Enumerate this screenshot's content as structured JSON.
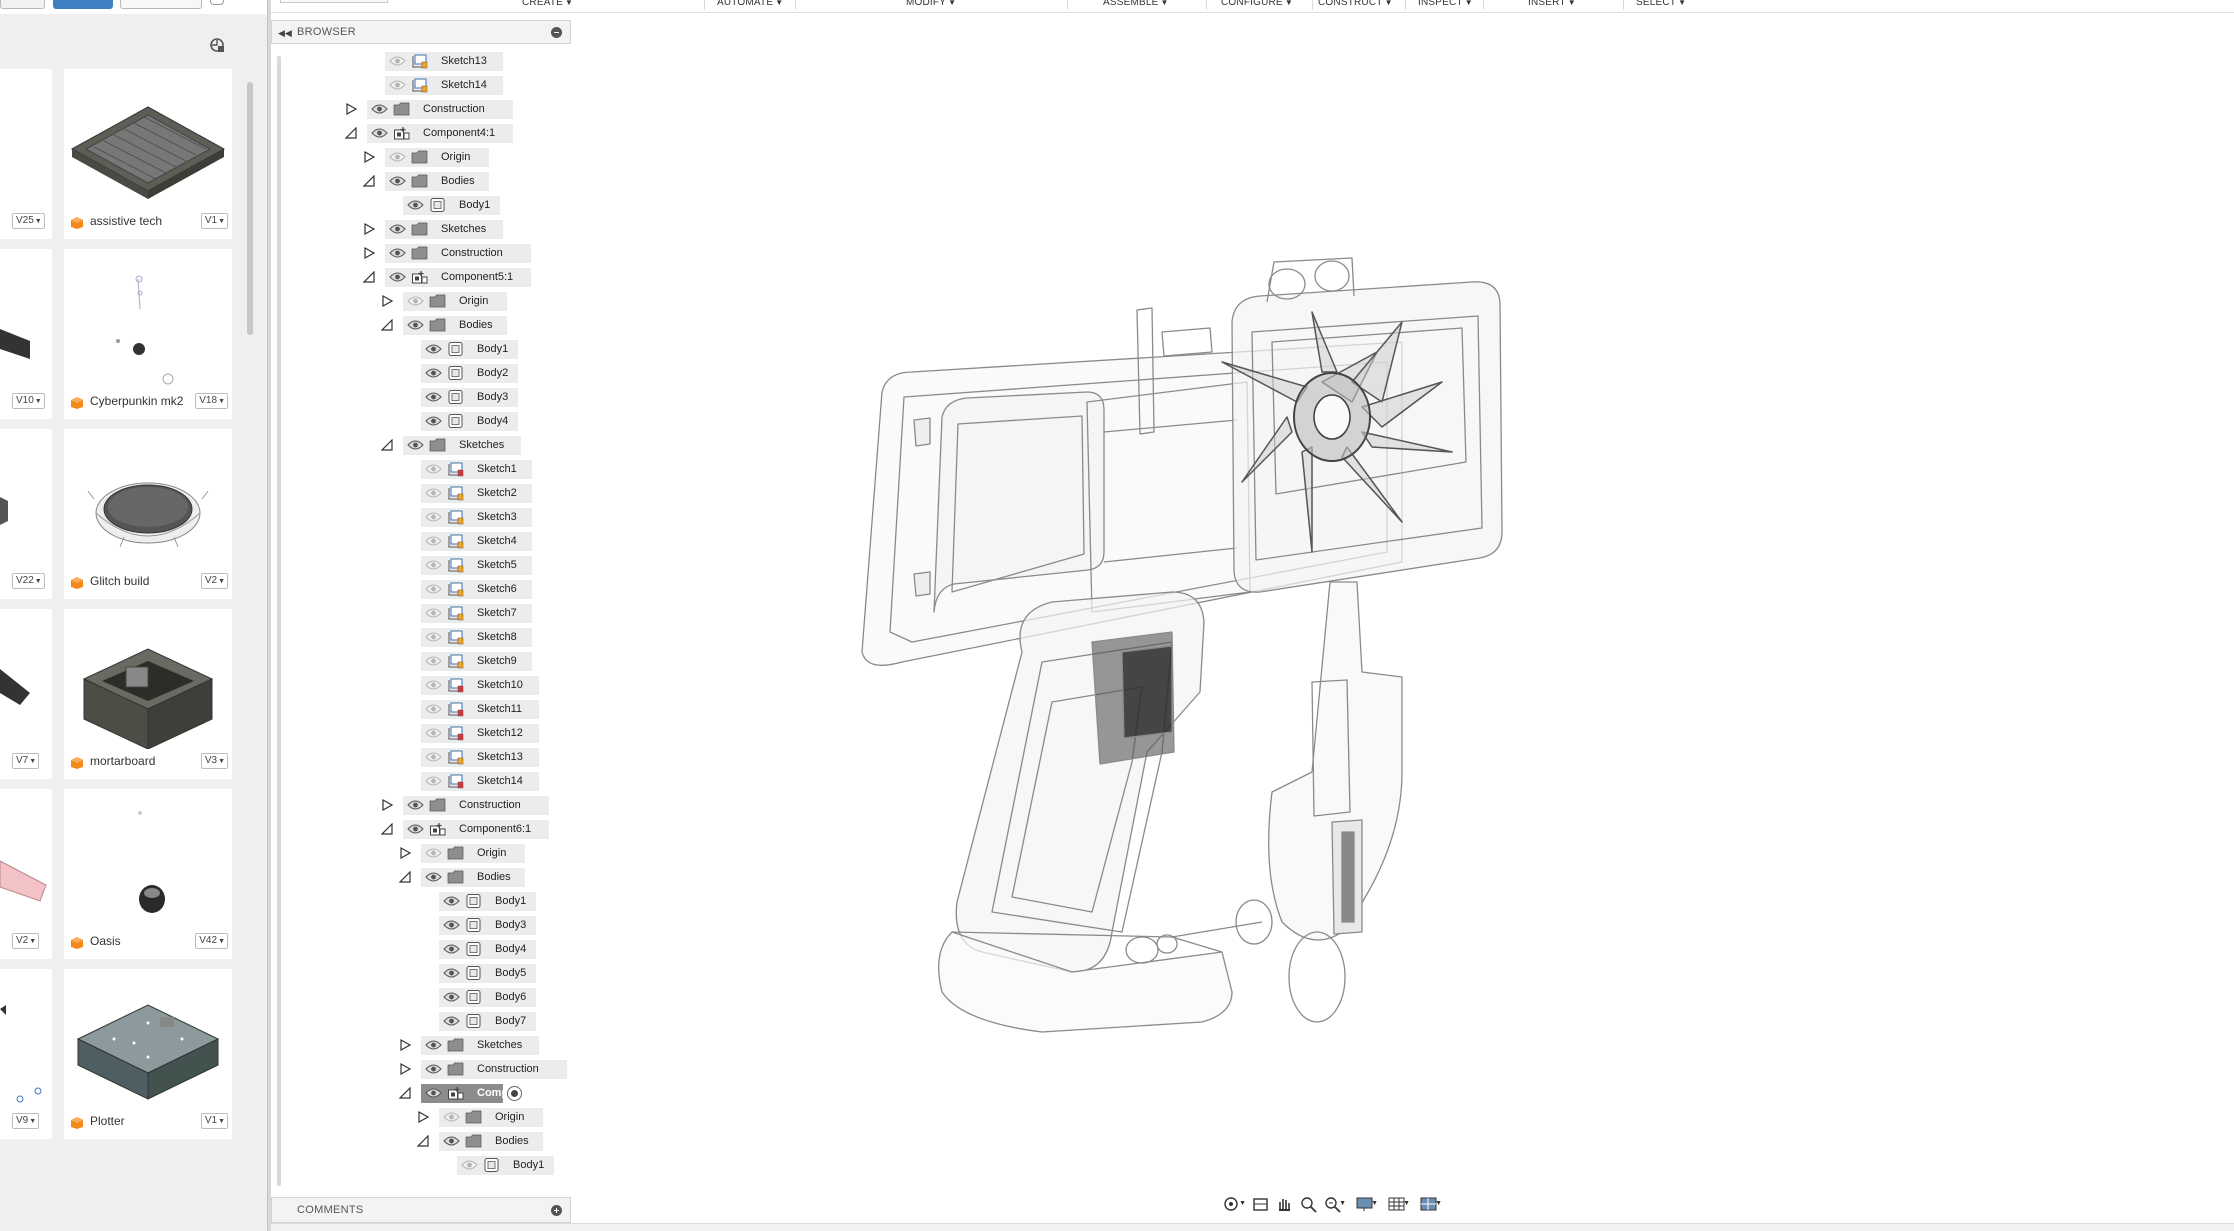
{
  "toolbar": {
    "menus": [
      {
        "label": "CREATE",
        "icon": "caret-down"
      },
      {
        "label": "AUTOMATE",
        "icon": "caret-down"
      },
      {
        "label": "MODIFY",
        "icon": "caret-down"
      },
      {
        "label": "ASSEMBLE",
        "icon": "caret-down"
      },
      {
        "label": "CONFIGURE",
        "icon": "caret-down"
      },
      {
        "label": "CONSTRUCT",
        "icon": "caret-down"
      },
      {
        "label": "INSPECT",
        "icon": "caret-down"
      },
      {
        "label": "INSERT",
        "icon": "caret-down"
      },
      {
        "label": "SELECT",
        "icon": "caret-down"
      }
    ]
  },
  "data_panel": {
    "designs": [
      {
        "name": "assistive tech",
        "version": "V1",
        "left_version": "V25"
      },
      {
        "name": "Cyberpunkin mk2",
        "version": "V18",
        "left_version": "V10"
      },
      {
        "name": "Glitch build",
        "version": "V2",
        "left_version": "V22"
      },
      {
        "name": "mortarboard",
        "version": "V3",
        "left_version": "V7"
      },
      {
        "name": "Oasis",
        "version": "V42",
        "left_version": "V2"
      },
      {
        "name": "Plotter",
        "version": "V1",
        "left_version": "V9"
      }
    ],
    "accent_color": "#f28a1c"
  },
  "browser": {
    "title": "BROWSER",
    "tree": [
      {
        "label": "Sketch13",
        "icon": "sketch",
        "visible": false
      },
      {
        "label": "Sketch14",
        "icon": "sketch",
        "visible": false
      },
      {
        "label": "Construction",
        "icon": "folder",
        "visible": true,
        "expander": "collapsed"
      },
      {
        "label": "Component4:1",
        "icon": "component",
        "visible": true,
        "expander": "expanded"
      },
      {
        "label": "Origin",
        "icon": "folder",
        "visible": false,
        "expander": "collapsed"
      },
      {
        "label": "Bodies",
        "icon": "folder",
        "visible": true,
        "expander": "expanded"
      },
      {
        "label": "Body1",
        "icon": "body",
        "visible": true
      },
      {
        "label": "Sketches",
        "icon": "folder",
        "visible": true,
        "expander": "collapsed"
      },
      {
        "label": "Construction",
        "icon": "folder",
        "visible": true,
        "expander": "collapsed"
      },
      {
        "label": "Component5:1",
        "icon": "component",
        "visible": true,
        "expander": "expanded"
      },
      {
        "label": "Origin",
        "icon": "folder",
        "visible": false,
        "expander": "collapsed"
      },
      {
        "label": "Bodies",
        "icon": "folder",
        "visible": true,
        "expander": "expanded"
      },
      {
        "label": "Body1",
        "icon": "body",
        "visible": true
      },
      {
        "label": "Body2",
        "icon": "body",
        "visible": true
      },
      {
        "label": "Body3",
        "icon": "body",
        "visible": true
      },
      {
        "label": "Body4",
        "icon": "body",
        "visible": true
      },
      {
        "label": "Sketches",
        "icon": "folder",
        "visible": true,
        "expander": "expanded"
      },
      {
        "label": "Sketch1",
        "icon": "sketch-error",
        "visible": false
      },
      {
        "label": "Sketch2",
        "icon": "sketch",
        "visible": false
      },
      {
        "label": "Sketch3",
        "icon": "sketch",
        "visible": false
      },
      {
        "label": "Sketch4",
        "icon": "sketch",
        "visible": false
      },
      {
        "label": "Sketch5",
        "icon": "sketch",
        "visible": false
      },
      {
        "label": "Sketch6",
        "icon": "sketch",
        "visible": false
      },
      {
        "label": "Sketch7",
        "icon": "sketch",
        "visible": false
      },
      {
        "label": "Sketch8",
        "icon": "sketch",
        "visible": false
      },
      {
        "label": "Sketch9",
        "icon": "sketch",
        "visible": false
      },
      {
        "label": "Sketch10",
        "icon": "sketch-error",
        "visible": false
      },
      {
        "label": "Sketch11",
        "icon": "sketch-error",
        "visible": false
      },
      {
        "label": "Sketch12",
        "icon": "sketch-error",
        "visible": false
      },
      {
        "label": "Sketch13",
        "icon": "sketch",
        "visible": false
      },
      {
        "label": "Sketch14",
        "icon": "sketch-error",
        "visible": false
      },
      {
        "label": "Construction",
        "icon": "folder",
        "visible": true,
        "expander": "collapsed"
      },
      {
        "label": "Component6:1",
        "icon": "component",
        "visible": true,
        "expander": "expanded"
      },
      {
        "label": "Origin",
        "icon": "folder",
        "visible": false,
        "expander": "collapsed"
      },
      {
        "label": "Bodies",
        "icon": "folder",
        "visible": true,
        "expander": "expanded"
      },
      {
        "label": "Body1",
        "icon": "body",
        "visible": true
      },
      {
        "label": "Body3",
        "icon": "body",
        "visible": true
      },
      {
        "label": "Body4",
        "icon": "body",
        "visible": true
      },
      {
        "label": "Body5",
        "icon": "body",
        "visible": true
      },
      {
        "label": "Body6",
        "icon": "body",
        "visible": true
      },
      {
        "label": "Body7",
        "icon": "body",
        "visible": true
      },
      {
        "label": "Sketches",
        "icon": "folder",
        "visible": true,
        "expander": "collapsed"
      },
      {
        "label": "Construction",
        "icon": "folder",
        "visible": true,
        "expander": "collapsed"
      },
      {
        "label": "Comp...",
        "icon": "component",
        "visible": true,
        "expander": "expanded",
        "selected": true
      },
      {
        "label": "Origin",
        "icon": "folder",
        "visible": false,
        "expander": "collapsed"
      },
      {
        "label": "Bodies",
        "icon": "folder",
        "visible": true,
        "expander": "expanded"
      },
      {
        "label": "Body1",
        "icon": "body",
        "visible": false
      }
    ]
  },
  "comments": {
    "title": "COMMENTS"
  },
  "nav_bar": {
    "tools": [
      "orbit-icon",
      "look-at-icon",
      "pan-icon",
      "zoom-window-icon",
      "zoom-icon",
      "display-settings-icon",
      "grid-settings-icon",
      "viewports-icon"
    ]
  }
}
